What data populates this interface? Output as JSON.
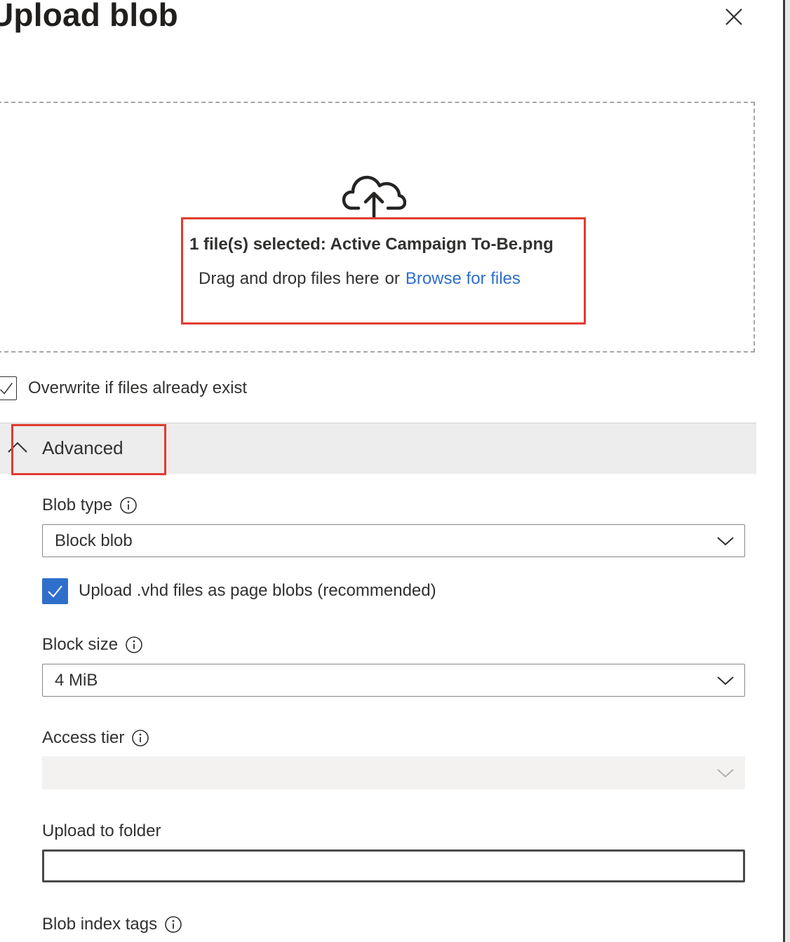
{
  "panel": {
    "title": "Upload blob"
  },
  "drop_zone": {
    "selected_text": "1 file(s) selected: Active Campaign To-Be.png",
    "drag_text": "Drag and drop files here",
    "or_text": "or",
    "browse_label": "Browse for files"
  },
  "overwrite": {
    "label": "Overwrite if files already exist",
    "checked": true
  },
  "advanced": {
    "label": "Advanced",
    "expanded": true
  },
  "blob_type": {
    "label": "Blob type",
    "value": "Block blob"
  },
  "vhd": {
    "label": "Upload .vhd files as page blobs (recommended)",
    "checked": true
  },
  "block_size": {
    "label": "Block size",
    "value": "4 MiB"
  },
  "access_tier": {
    "label": "Access tier",
    "value": "",
    "disabled": true
  },
  "upload_folder": {
    "label": "Upload to folder",
    "value": ""
  },
  "index_tags": {
    "label": "Blob index tags"
  },
  "colors": {
    "accent": "#2f6fcb",
    "highlight": "#e03c31",
    "advanced_bg": "#ededed"
  },
  "icons": [
    "close-icon",
    "cloud-upload-icon",
    "checkmark-icon",
    "chevron-up-icon",
    "info-icon",
    "chevron-down-icon"
  ]
}
